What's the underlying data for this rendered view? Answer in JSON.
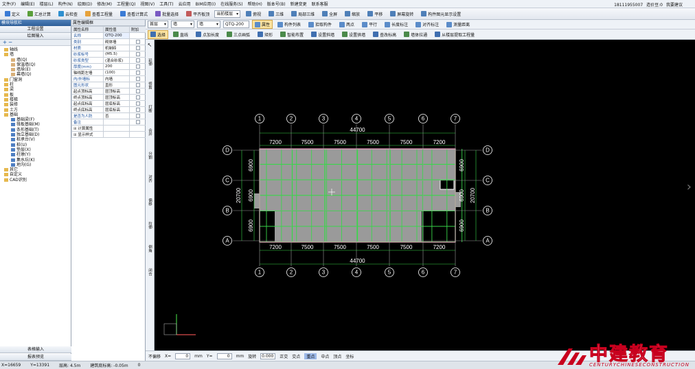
{
  "menubar": {
    "items": [
      "文件(F)",
      "编辑(E)",
      "楼层(L)",
      "构件(N)",
      "绘图(D)",
      "修改(M)",
      "工程量(Q)",
      "视图(V)",
      "工具(T)",
      "云应用",
      "BIM应用(I)",
      "在线服务(S)",
      "帮助(H)",
      "版本号(B)",
      "新建变更",
      "联系客服"
    ],
    "phone": "18111955007",
    "coins": "造价豆:0",
    "feedback": "我要建议"
  },
  "toolbar1": [
    "定义",
    "汇总计算",
    "云检查",
    "查看工程量",
    "查看计算式",
    "批量选择",
    "平齐板顶"
  ],
  "toolbar1_selects": [
    "当前楼层"
  ],
  "toolbar1_right": [
    "俯视",
    "三维",
    "局部三维",
    "全屏",
    "缩放",
    "平移",
    "屏幕旋转",
    "构件图元显示设置"
  ],
  "left_panel": {
    "title": "模块导航栏",
    "tabs": [
      "工程设置",
      "绘图输入"
    ],
    "tree": [
      {
        "label": "轴线",
        "level": 0,
        "color": "#e6b84d"
      },
      {
        "label": "墙",
        "level": 0,
        "color": "#e6b84d"
      },
      {
        "label": "墙(Q)",
        "level": 1,
        "color": "#d8b07a"
      },
      {
        "label": "保温墙(Q)",
        "level": 1,
        "color": "#d8b07a"
      },
      {
        "label": "墙垛(E)",
        "level": 1,
        "color": "#d8b07a"
      },
      {
        "label": "幕墙(Q)",
        "level": 1,
        "color": "#d8b07a"
      },
      {
        "label": "门窗洞",
        "level": 0,
        "color": "#e6b84d"
      },
      {
        "label": "柱",
        "level": 0,
        "color": "#e6b84d"
      },
      {
        "label": "梁",
        "level": 0,
        "color": "#e6b84d"
      },
      {
        "label": "板",
        "level": 0,
        "color": "#e6b84d"
      },
      {
        "label": "楼梯",
        "level": 0,
        "color": "#e6b84d"
      },
      {
        "label": "装修",
        "level": 0,
        "color": "#e6b84d"
      },
      {
        "label": "土方",
        "level": 0,
        "color": "#e6b84d"
      },
      {
        "label": "基础",
        "level": 0,
        "color": "#e6b84d"
      },
      {
        "label": "基础梁(F)",
        "level": 1,
        "color": "#4f7fc2"
      },
      {
        "label": "筏板基础(M)",
        "level": 1,
        "color": "#4f7fc2"
      },
      {
        "label": "条形基础(T)",
        "level": 1,
        "color": "#4f7fc2"
      },
      {
        "label": "独立基础(D)",
        "level": 1,
        "color": "#4f7fc2"
      },
      {
        "label": "桩承台(V)",
        "level": 1,
        "color": "#4f7fc2"
      },
      {
        "label": "桩(U)",
        "level": 1,
        "color": "#4f7fc2"
      },
      {
        "label": "垫层(X)",
        "level": 1,
        "color": "#4f7fc2"
      },
      {
        "label": "柱墩(Y)",
        "level": 1,
        "color": "#4f7fc2"
      },
      {
        "label": "集水坑(K)",
        "level": 1,
        "color": "#4f7fc2"
      },
      {
        "label": "地沟(G)",
        "level": 1,
        "color": "#4f7fc2"
      },
      {
        "label": "其它",
        "level": 0,
        "color": "#e6b84d"
      },
      {
        "label": "自定义",
        "level": 0,
        "color": "#e6b84d"
      },
      {
        "label": "CAD识别",
        "level": 0,
        "color": "#e6b84d"
      }
    ],
    "bottom": [
      "表格输入",
      "报表预览"
    ]
  },
  "props_panel": {
    "title": "属性编辑框",
    "headers": [
      "属性名称",
      "属性值",
      "附加"
    ],
    "rows": [
      {
        "name": "名称",
        "value": "QTQ-200",
        "blue": true,
        "check": false
      },
      {
        "name": "类别",
        "value": "砌体墙",
        "blue": true,
        "check": true
      },
      {
        "name": "材质",
        "value": "机制砖",
        "blue": true,
        "check": true
      },
      {
        "name": "砂浆标号",
        "value": "(M5.5)",
        "blue": true,
        "check": true
      },
      {
        "name": "砂浆类型",
        "value": "(混合砂浆)",
        "blue": true,
        "check": true
      },
      {
        "name": "厚度(mm)",
        "value": "200",
        "blue": true,
        "check": true
      },
      {
        "name": "轴线距左墙",
        "value": "(100)",
        "blue": false,
        "check": true
      },
      {
        "name": "内/外墙标",
        "value": "内墙",
        "blue": true,
        "check": true
      },
      {
        "name": "图元形状",
        "value": "直形",
        "blue": true,
        "check": true
      },
      {
        "name": "起点顶标高",
        "value": "层顶标高",
        "blue": false,
        "check": true
      },
      {
        "name": "终点顶标高",
        "value": "层顶标高",
        "blue": false,
        "check": true
      },
      {
        "name": "起点底标高",
        "value": "层底标高",
        "blue": false,
        "check": true
      },
      {
        "name": "终点底标高",
        "value": "层底标高",
        "blue": false,
        "check": true
      },
      {
        "name": "是否为人防",
        "value": "否",
        "blue": true,
        "check": true
      },
      {
        "name": "备注",
        "value": "",
        "blue": true,
        "check": true
      },
      {
        "name": "计算属性",
        "value": "",
        "blue": false,
        "check": false,
        "group": true
      },
      {
        "name": "显示样式",
        "value": "",
        "blue": false,
        "check": false,
        "group": true
      }
    ]
  },
  "toolbar2": {
    "selects": [
      "首层",
      "墙",
      "墙",
      "QTQ-200"
    ],
    "buttons": [
      "属性",
      "构件列表",
      "拾取构件",
      "两点",
      "平行",
      "长度标注",
      "对齐标注",
      "测量距离"
    ]
  },
  "toolbar3": {
    "buttons": [
      "选择",
      "直线",
      "点加长度",
      "三点画弧",
      "矩形",
      "智能布置",
      "设置斜墙",
      "设置拱墙",
      "查改标高",
      "墙体拉通",
      "从楼层提取工程量"
    ]
  },
  "vtoolbar": [
    "延伸",
    "修剪",
    "打断",
    "合并",
    "分割",
    "对齐",
    "偏移",
    "拉伸",
    "倒角",
    "闭合"
  ],
  "drawing": {
    "top_axes": [
      "1",
      "2",
      "3",
      "4",
      "5",
      "6",
      "7"
    ],
    "row_axes": [
      "D",
      "C",
      "B",
      "A"
    ],
    "top_total": "44700",
    "top_spans": [
      "7200",
      "7500",
      "7500",
      "7500",
      "7500",
      "7200"
    ],
    "bottom_total": "44700",
    "bottom_spans": [
      "7200",
      "7500",
      "7500",
      "7500",
      "7500",
      "7200"
    ],
    "left_total": "20700",
    "left_spans": [
      "6900",
      "6900",
      "6900"
    ],
    "right_total": "20700",
    "right_spans": [
      "6900",
      "6900",
      "6900"
    ]
  },
  "statusbar": {
    "items": [
      "不偏移",
      "X=",
      "0",
      "mm",
      "Y=",
      "0",
      "mm",
      "旋转",
      "0.000",
      "正交",
      "交点",
      "重点",
      "中点",
      "顶点",
      "坐标"
    ]
  },
  "footer": {
    "items": [
      "X=16659",
      "Y=13391",
      "层高: 4.5m",
      "建筑底标高: -0.05m",
      "0"
    ]
  },
  "logo": {
    "cn": "中建教育",
    "en": "CENTURYCHINESECONSTRUCTION"
  }
}
